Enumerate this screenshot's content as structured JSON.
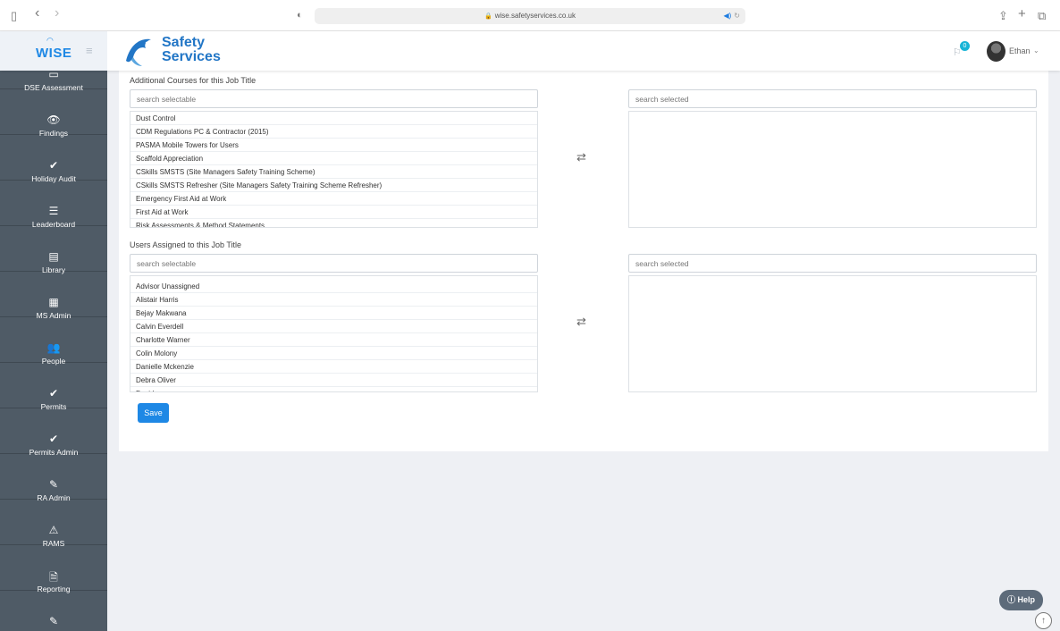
{
  "browser": {
    "url": "wise.safetyservices.co.uk",
    "sidebar_toggle_icon": "▯",
    "back_icon": "‹",
    "forward_icon": "›",
    "shield_icon": "◐",
    "lock_icon": "🔒",
    "audio_icon": "◀)",
    "reload_icon": "↻",
    "share_icon": "⇪",
    "new_tab_icon": "+",
    "tabs_icon": "⧉"
  },
  "header": {
    "app_logo": "WISE",
    "brand_line1": "Safety",
    "brand_line2": "Services",
    "notification_count": "0",
    "user_name": "Ethan"
  },
  "sidebar": {
    "items": [
      {
        "label": "DSE Assessment",
        "icon": "▭"
      },
      {
        "label": "Findings",
        "icon": "👁"
      },
      {
        "label": "Holiday Audit",
        "icon": "✔"
      },
      {
        "label": "Leaderboard",
        "icon": "☰"
      },
      {
        "label": "Library",
        "icon": "▤"
      },
      {
        "label": "MS Admin",
        "icon": "▦"
      },
      {
        "label": "People",
        "icon": "👥"
      },
      {
        "label": "Permits",
        "icon": "✔"
      },
      {
        "label": "Permits Admin",
        "icon": "✔"
      },
      {
        "label": "RA Admin",
        "icon": "✎"
      },
      {
        "label": "RAMS",
        "icon": "⚠"
      },
      {
        "label": "Reporting",
        "icon": "🗎"
      },
      {
        "label": "",
        "icon": "✎"
      }
    ]
  },
  "courses": {
    "label": "Additional Courses for this Job Title",
    "selectable_placeholder": "search selectable",
    "selected_placeholder": "search selected",
    "items": [
      "Dust Control",
      "CDM Regulations PC & Contractor (2015)",
      "PASMA Mobile Towers for Users",
      "Scaffold Appreciation",
      "CSkills SMSTS (Site Managers Safety Training Scheme)",
      "CSkills SMSTS Refresher (Site Managers Safety Training Scheme Refresher)",
      "Emergency First Aid at Work",
      "First Aid at Work",
      "Risk Assessments & Method Statements"
    ]
  },
  "users": {
    "label": "Users Assigned to this Job Title",
    "selectable_placeholder": "search selectable",
    "selected_placeholder": "search selected",
    "items": [
      "Advisor Unassigned",
      "Alistair Harris",
      "Bejay Makwana",
      "Calvin Everdell",
      "Charlotte Warner",
      "Colin Molony",
      "Danielle Mckenzie",
      "Debra Oliver",
      "David..."
    ]
  },
  "actions": {
    "transfer_icon": "⇄",
    "save_label": "Save",
    "help_label": "Help",
    "scroll_top_icon": "↑"
  },
  "colors": {
    "accent": "#1e88e5",
    "sidebar_bg": "#4f5b66",
    "page_bg": "#eef0f4"
  }
}
